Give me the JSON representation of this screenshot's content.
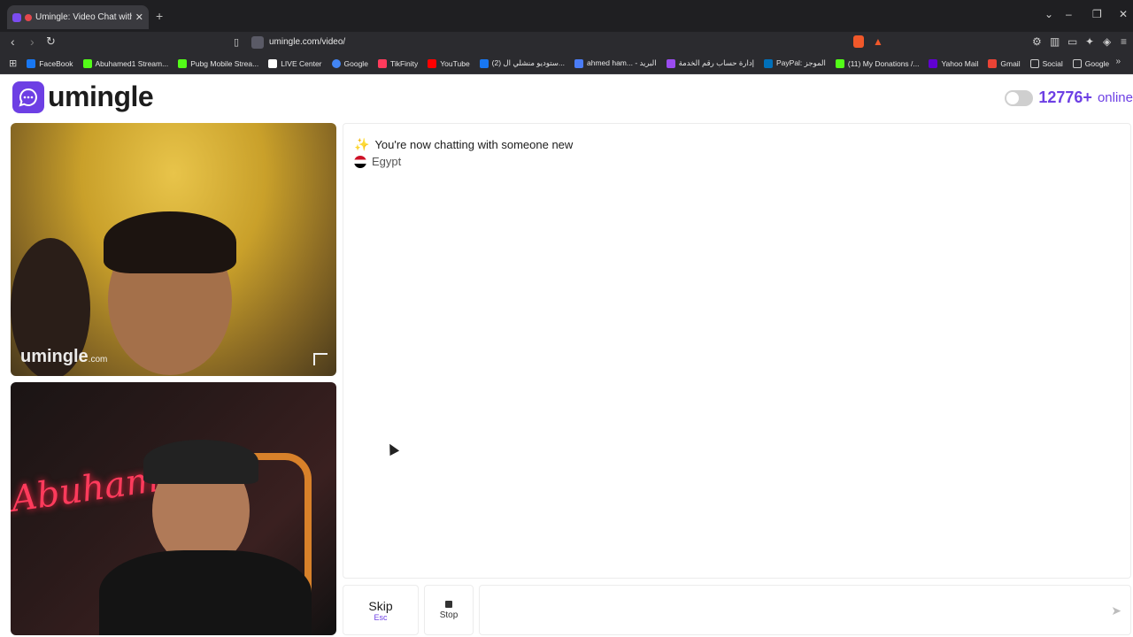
{
  "browser": {
    "tab_title": "Umingle: Video Chat with Stra",
    "url": "umingle.com/video/",
    "bookmarks": [
      {
        "label": "FaceBook",
        "color": "#1877f2"
      },
      {
        "label": "Abuhamed1 Stream...",
        "color": "#53fc18"
      },
      {
        "label": "Pubg Mobile Strea...",
        "color": "#53fc18"
      },
      {
        "label": "LIVE Center",
        "color": "#ffffff"
      },
      {
        "label": "Google",
        "color": "#4285f4"
      },
      {
        "label": "TikFinity",
        "color": "#ff3b5c"
      },
      {
        "label": "YouTube",
        "color": "#ff0000"
      },
      {
        "label": "(2) ستوديو منشلي ال...",
        "color": "#1877f2"
      },
      {
        "label": "ahmed ham... - البريد",
        "color": "#4a7cf6"
      },
      {
        "label": "إدارة حساب رقم الخدمة",
        "color": "#9b4cf0"
      },
      {
        "label": "PayPal: الموجز",
        "color": "#0070ba"
      },
      {
        "label": "(11) My Donations /...",
        "color": "#53fc18"
      },
      {
        "label": "Yahoo Mail",
        "color": "#6001d2"
      },
      {
        "label": "Gmail",
        "color": "#ea4335"
      },
      {
        "label": "Social",
        "color": "#cccccc"
      },
      {
        "label": "Google",
        "color": "#cccccc"
      }
    ]
  },
  "header": {
    "logo_text": "umingle",
    "online_count": "12776+",
    "online_label": "online"
  },
  "video": {
    "watermark": "umingle",
    "watermark_suffix": ".com",
    "neon_text": "Abuhamed"
  },
  "chat": {
    "system_message": "You're now chatting with someone new",
    "country": "Egypt"
  },
  "controls": {
    "skip_label": "Skip",
    "skip_key": "Esc",
    "stop_label": "Stop",
    "message_placeholder": ""
  },
  "colors": {
    "brand": "#6d3fe4"
  }
}
